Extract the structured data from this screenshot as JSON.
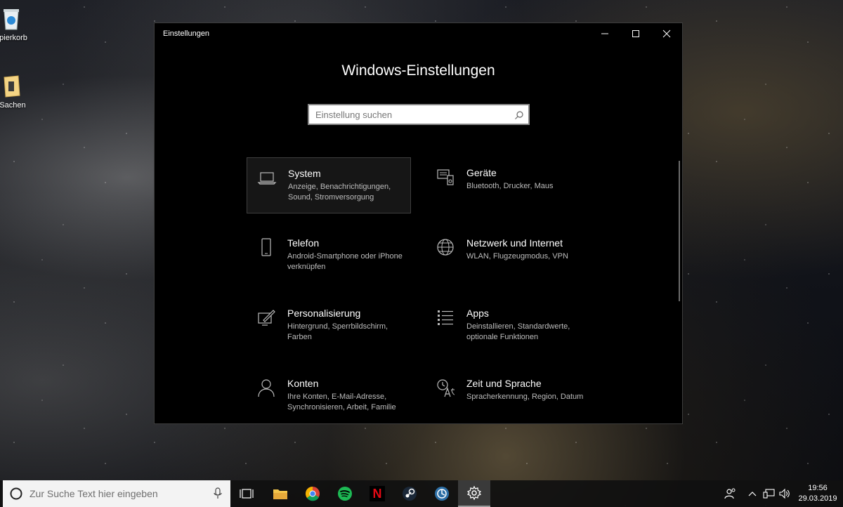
{
  "desktop": {
    "icons": [
      {
        "label": "apierkorb",
        "icon": "recycle-bin-icon"
      },
      {
        "label": "Sachen",
        "icon": "folder-icon"
      }
    ]
  },
  "window": {
    "title": "Einstellungen",
    "heading": "Windows-Einstellungen",
    "search_placeholder": "Einstellung suchen",
    "controls": [
      "minimize-icon",
      "maximize-icon",
      "close-icon"
    ]
  },
  "categories": [
    {
      "title": "System",
      "desc": "Anzeige, Benachrichtigungen, Sound, Stromversorgung",
      "icon": "laptop-icon",
      "selected": true
    },
    {
      "title": "Geräte",
      "desc": "Bluetooth, Drucker, Maus",
      "icon": "devices-icon"
    },
    {
      "title": "Telefon",
      "desc": "Android-Smartphone oder iPhone verknüpfen",
      "icon": "phone-icon"
    },
    {
      "title": "Netzwerk und Internet",
      "desc": "WLAN, Flugzeugmodus, VPN",
      "icon": "globe-icon"
    },
    {
      "title": "Personalisierung",
      "desc": "Hintergrund, Sperrbildschirm, Farben",
      "icon": "paint-icon"
    },
    {
      "title": "Apps",
      "desc": "Deinstallieren, Standardwerte, optionale Funktionen",
      "icon": "apps-list-icon"
    },
    {
      "title": "Konten",
      "desc": "Ihre Konten, E-Mail-Adresse, Synchronisieren, Arbeit, Familie",
      "icon": "person-icon"
    },
    {
      "title": "Zeit und Sprache",
      "desc": "Spracherkennung, Region, Datum",
      "icon": "time-language-icon"
    }
  ],
  "taskbar": {
    "search_placeholder": "Zur Suche Text hier eingeben",
    "apps": [
      "task-view-icon",
      "file-explorer-icon",
      "chrome-icon",
      "spotify-icon",
      "netflix-icon",
      "steam-icon",
      "app-icon",
      "settings-gear-icon"
    ],
    "netflix_letter": "N",
    "time": "19:56",
    "date": "29.03.2019"
  },
  "colors": {
    "window_bg": "#000000",
    "text": "#ffffff",
    "desc": "#bdbdbd",
    "chrome_red": "#db4437",
    "spotify_green": "#1db954",
    "netflix_red": "#e50914"
  }
}
